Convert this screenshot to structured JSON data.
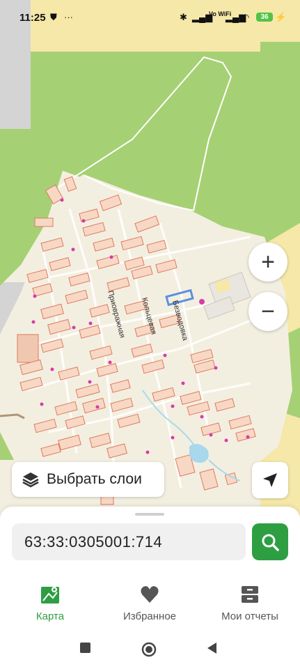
{
  "status_bar": {
    "time": "11:25",
    "battery": "36",
    "network": "Vo WiFi"
  },
  "map": {
    "street_labels": [
      "Приовражная",
      "Кольцевая",
      "Безводовка"
    ],
    "zoom_in_label": "+",
    "zoom_out_label": "−"
  },
  "layers_button": {
    "label": "Выбрать слои"
  },
  "search": {
    "value": "63:33:0305001:714"
  },
  "bottom_nav": {
    "items": [
      {
        "label": "Карта",
        "icon": "map-icon",
        "active": true
      },
      {
        "label": "Избранное",
        "icon": "heart-icon",
        "active": false
      },
      {
        "label": "Мои отчеты",
        "icon": "archive-icon",
        "active": false
      }
    ]
  },
  "colors": {
    "accent": "#2e9e42",
    "forest": "#a6d074",
    "settlement": "#f3efe0",
    "parcel_fill": "#f7d8c4",
    "parcel_stroke": "#e07860",
    "highlight": "#5b8fe0"
  }
}
